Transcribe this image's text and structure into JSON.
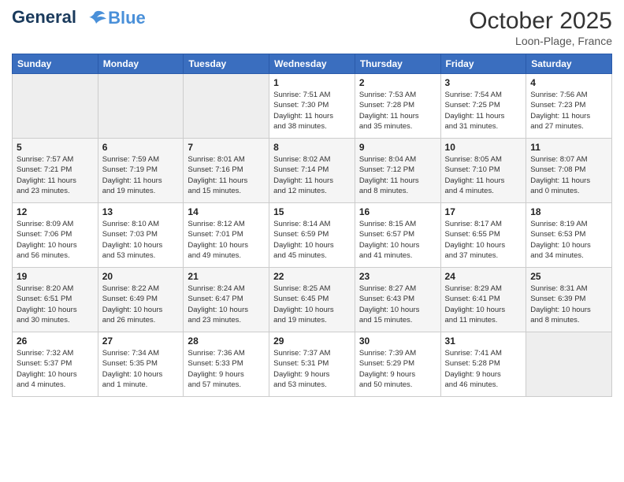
{
  "header": {
    "logo_line1": "General",
    "logo_line2": "Blue",
    "month": "October 2025",
    "location": "Loon-Plage, France"
  },
  "weekdays": [
    "Sunday",
    "Monday",
    "Tuesday",
    "Wednesday",
    "Thursday",
    "Friday",
    "Saturday"
  ],
  "weeks": [
    [
      {
        "day": "",
        "info": ""
      },
      {
        "day": "",
        "info": ""
      },
      {
        "day": "",
        "info": ""
      },
      {
        "day": "1",
        "info": "Sunrise: 7:51 AM\nSunset: 7:30 PM\nDaylight: 11 hours\nand 38 minutes."
      },
      {
        "day": "2",
        "info": "Sunrise: 7:53 AM\nSunset: 7:28 PM\nDaylight: 11 hours\nand 35 minutes."
      },
      {
        "day": "3",
        "info": "Sunrise: 7:54 AM\nSunset: 7:25 PM\nDaylight: 11 hours\nand 31 minutes."
      },
      {
        "day": "4",
        "info": "Sunrise: 7:56 AM\nSunset: 7:23 PM\nDaylight: 11 hours\nand 27 minutes."
      }
    ],
    [
      {
        "day": "5",
        "info": "Sunrise: 7:57 AM\nSunset: 7:21 PM\nDaylight: 11 hours\nand 23 minutes."
      },
      {
        "day": "6",
        "info": "Sunrise: 7:59 AM\nSunset: 7:19 PM\nDaylight: 11 hours\nand 19 minutes."
      },
      {
        "day": "7",
        "info": "Sunrise: 8:01 AM\nSunset: 7:16 PM\nDaylight: 11 hours\nand 15 minutes."
      },
      {
        "day": "8",
        "info": "Sunrise: 8:02 AM\nSunset: 7:14 PM\nDaylight: 11 hours\nand 12 minutes."
      },
      {
        "day": "9",
        "info": "Sunrise: 8:04 AM\nSunset: 7:12 PM\nDaylight: 11 hours\nand 8 minutes."
      },
      {
        "day": "10",
        "info": "Sunrise: 8:05 AM\nSunset: 7:10 PM\nDaylight: 11 hours\nand 4 minutes."
      },
      {
        "day": "11",
        "info": "Sunrise: 8:07 AM\nSunset: 7:08 PM\nDaylight: 11 hours\nand 0 minutes."
      }
    ],
    [
      {
        "day": "12",
        "info": "Sunrise: 8:09 AM\nSunset: 7:06 PM\nDaylight: 10 hours\nand 56 minutes."
      },
      {
        "day": "13",
        "info": "Sunrise: 8:10 AM\nSunset: 7:03 PM\nDaylight: 10 hours\nand 53 minutes."
      },
      {
        "day": "14",
        "info": "Sunrise: 8:12 AM\nSunset: 7:01 PM\nDaylight: 10 hours\nand 49 minutes."
      },
      {
        "day": "15",
        "info": "Sunrise: 8:14 AM\nSunset: 6:59 PM\nDaylight: 10 hours\nand 45 minutes."
      },
      {
        "day": "16",
        "info": "Sunrise: 8:15 AM\nSunset: 6:57 PM\nDaylight: 10 hours\nand 41 minutes."
      },
      {
        "day": "17",
        "info": "Sunrise: 8:17 AM\nSunset: 6:55 PM\nDaylight: 10 hours\nand 37 minutes."
      },
      {
        "day": "18",
        "info": "Sunrise: 8:19 AM\nSunset: 6:53 PM\nDaylight: 10 hours\nand 34 minutes."
      }
    ],
    [
      {
        "day": "19",
        "info": "Sunrise: 8:20 AM\nSunset: 6:51 PM\nDaylight: 10 hours\nand 30 minutes."
      },
      {
        "day": "20",
        "info": "Sunrise: 8:22 AM\nSunset: 6:49 PM\nDaylight: 10 hours\nand 26 minutes."
      },
      {
        "day": "21",
        "info": "Sunrise: 8:24 AM\nSunset: 6:47 PM\nDaylight: 10 hours\nand 23 minutes."
      },
      {
        "day": "22",
        "info": "Sunrise: 8:25 AM\nSunset: 6:45 PM\nDaylight: 10 hours\nand 19 minutes."
      },
      {
        "day": "23",
        "info": "Sunrise: 8:27 AM\nSunset: 6:43 PM\nDaylight: 10 hours\nand 15 minutes."
      },
      {
        "day": "24",
        "info": "Sunrise: 8:29 AM\nSunset: 6:41 PM\nDaylight: 10 hours\nand 11 minutes."
      },
      {
        "day": "25",
        "info": "Sunrise: 8:31 AM\nSunset: 6:39 PM\nDaylight: 10 hours\nand 8 minutes."
      }
    ],
    [
      {
        "day": "26",
        "info": "Sunrise: 7:32 AM\nSunset: 5:37 PM\nDaylight: 10 hours\nand 4 minutes."
      },
      {
        "day": "27",
        "info": "Sunrise: 7:34 AM\nSunset: 5:35 PM\nDaylight: 10 hours\nand 1 minute."
      },
      {
        "day": "28",
        "info": "Sunrise: 7:36 AM\nSunset: 5:33 PM\nDaylight: 9 hours\nand 57 minutes."
      },
      {
        "day": "29",
        "info": "Sunrise: 7:37 AM\nSunset: 5:31 PM\nDaylight: 9 hours\nand 53 minutes."
      },
      {
        "day": "30",
        "info": "Sunrise: 7:39 AM\nSunset: 5:29 PM\nDaylight: 9 hours\nand 50 minutes."
      },
      {
        "day": "31",
        "info": "Sunrise: 7:41 AM\nSunset: 5:28 PM\nDaylight: 9 hours\nand 46 minutes."
      },
      {
        "day": "",
        "info": ""
      }
    ]
  ]
}
